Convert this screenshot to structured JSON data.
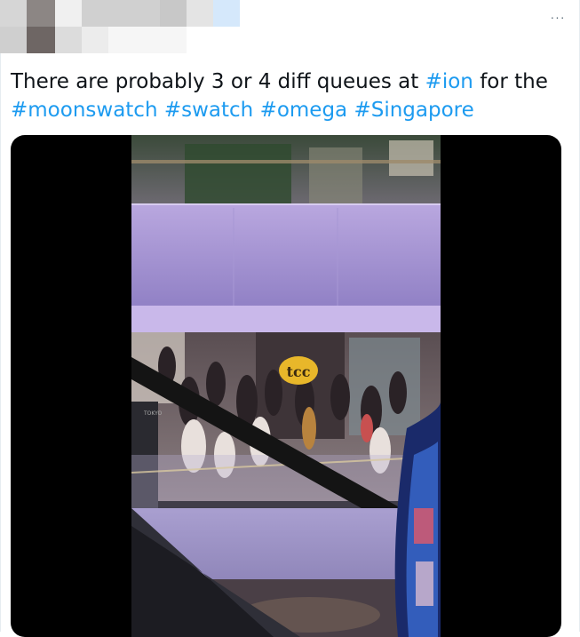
{
  "tweet": {
    "text_parts": [
      {
        "kind": "text",
        "value": "There are probably 3 or 4 diff queues at "
      },
      {
        "kind": "hashtag",
        "value": "#ion"
      },
      {
        "kind": "text",
        "value": " for the "
      },
      {
        "kind": "hashtag",
        "value": "#moonswatch"
      },
      {
        "kind": "text",
        "value": " "
      },
      {
        "kind": "hashtag",
        "value": "#swatch"
      },
      {
        "kind": "text",
        "value": " "
      },
      {
        "kind": "hashtag",
        "value": "#omega"
      },
      {
        "kind": "text",
        "value": " "
      },
      {
        "kind": "hashtag",
        "value": "#Singapore"
      }
    ],
    "more_icon": "more-horizontal-icon",
    "more_label": "···"
  },
  "media": {
    "store_sign": "tcc",
    "store_side_text": "TOKYO"
  },
  "colors": {
    "hashtag": "#1d9bf0",
    "text": "#0f1419",
    "media_bg": "#000000",
    "sign": "#e8b72a"
  }
}
